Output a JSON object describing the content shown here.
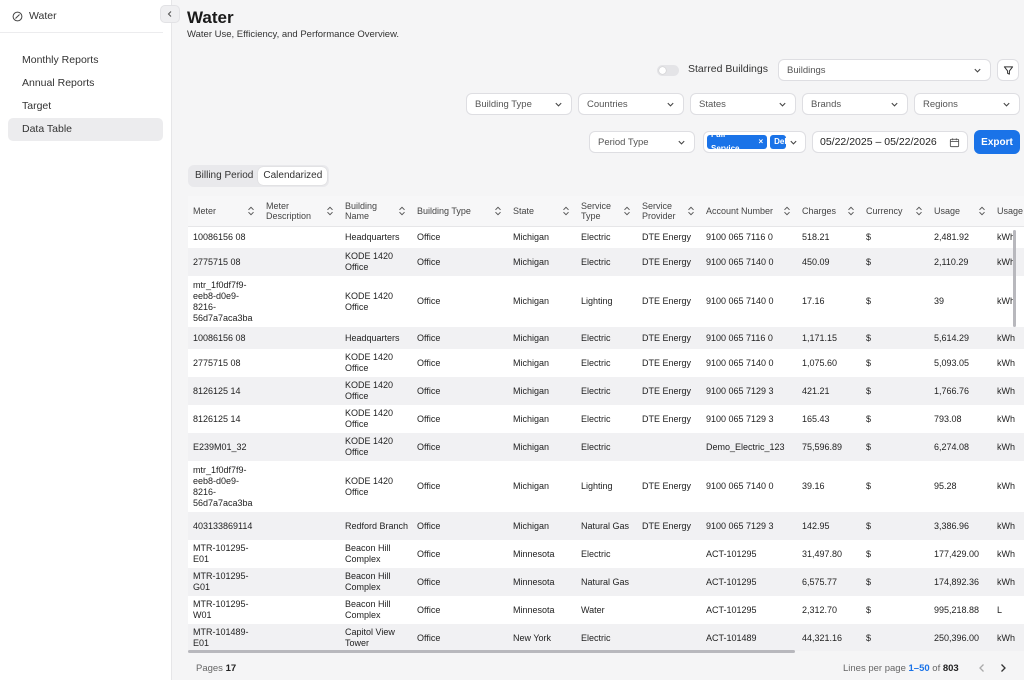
{
  "app": {
    "section_title": "Water",
    "section_icon": "leaf-icon"
  },
  "sidebar": {
    "items": [
      {
        "label": "Monthly Reports"
      },
      {
        "label": "Annual Reports"
      },
      {
        "label": "Target"
      },
      {
        "label": "Data Table",
        "active": true
      }
    ]
  },
  "header": {
    "title": "Water",
    "subtitle": "Water Use, Efficiency, and Performance Overview."
  },
  "filters": {
    "starred_label": "Starred Buildings",
    "buildings_placeholder": "Buildings",
    "building_type": "Building Type",
    "countries": "Countries",
    "states": "States",
    "brands": "Brands",
    "regions": "Regions",
    "period_type": "Period Type",
    "service_chips": [
      "Full Service",
      "Deli"
    ],
    "date_range": "05/22/2025 – 05/22/2026",
    "export_label": "Export"
  },
  "view_toggle": {
    "billing_period": "Billing Period",
    "calendarized": "Calendarized",
    "active": "Calendarized"
  },
  "table": {
    "columns": [
      "Meter",
      "Meter Description",
      "Building Name",
      "Building Type",
      "State",
      "Service Type",
      "Service Provider",
      "Account Number",
      "Charges",
      "Currency",
      "Usage",
      "Usage Unit"
    ],
    "rows": [
      [
        "10086156 08",
        "",
        "Headquarters",
        "Office",
        "Michigan",
        "Electric",
        "DTE Energy",
        "9100 065 7116 0",
        "518.21",
        "$",
        "2,481.92",
        "kWh"
      ],
      [
        "2775715 08",
        "",
        "KODE 1420 Office",
        "Office",
        "Michigan",
        "Electric",
        "DTE Energy",
        "9100 065 7140 0",
        "450.09",
        "$",
        "2,110.29",
        "kWh"
      ],
      [
        "mtr_1f0df7f9-eeb8-d0e9-8216-56d7a7aca3ba",
        "",
        "KODE 1420 Office",
        "Office",
        "Michigan",
        "Lighting",
        "DTE Energy",
        "9100 065 7140 0",
        "17.16",
        "$",
        "39",
        "kWh"
      ],
      [
        "10086156 08",
        "",
        "Headquarters",
        "Office",
        "Michigan",
        "Electric",
        "DTE Energy",
        "9100 065 7116 0",
        "1,171.15",
        "$",
        "5,614.29",
        "kWh"
      ],
      [
        "2775715 08",
        "",
        "KODE 1420 Office",
        "Office",
        "Michigan",
        "Electric",
        "DTE Energy",
        "9100 065 7140 0",
        "1,075.60",
        "$",
        "5,093.05",
        "kWh"
      ],
      [
        "8126125 14",
        "",
        "KODE 1420 Office",
        "Office",
        "Michigan",
        "Electric",
        "DTE Energy",
        "9100 065 7129 3",
        "421.21",
        "$",
        "1,766.76",
        "kWh"
      ],
      [
        "8126125 14",
        "",
        "KODE 1420 Office",
        "Office",
        "Michigan",
        "Electric",
        "DTE Energy",
        "9100 065 7129 3",
        "165.43",
        "$",
        "793.08",
        "kWh"
      ],
      [
        "E239M01_32",
        "",
        "KODE 1420 Office",
        "Office",
        "Michigan",
        "Electric",
        "",
        "Demo_Electric_123",
        "75,596.89",
        "$",
        "6,274.08",
        "kWh"
      ],
      [
        "mtr_1f0df7f9-eeb8-d0e9-8216-56d7a7aca3ba",
        "",
        "KODE 1420 Office",
        "Office",
        "Michigan",
        "Lighting",
        "DTE Energy",
        "9100 065 7140 0",
        "39.16",
        "$",
        "95.28",
        "kWh"
      ],
      [
        "403133869114",
        "",
        "Redford Branch",
        "Office",
        "Michigan",
        "Natural Gas",
        "DTE Energy",
        "9100 065 7129 3",
        "142.95",
        "$",
        "3,386.96",
        "kWh"
      ],
      [
        "MTR-101295-E01",
        "",
        "Beacon Hill Complex",
        "Office",
        "Minnesota",
        "Electric",
        "",
        "ACT-101295",
        "31,497.80",
        "$",
        "177,429.00",
        "kWh"
      ],
      [
        "MTR-101295-G01",
        "",
        "Beacon Hill Complex",
        "Office",
        "Minnesota",
        "Natural Gas",
        "",
        "ACT-101295",
        "6,575.77",
        "$",
        "174,892.36",
        "kWh"
      ],
      [
        "MTR-101295-W01",
        "",
        "Beacon Hill Complex",
        "Office",
        "Minnesota",
        "Water",
        "",
        "ACT-101295",
        "2,312.70",
        "$",
        "995,218.88",
        "L"
      ],
      [
        "MTR-101489-E01",
        "",
        "Capitol View Tower",
        "Office",
        "New York",
        "Electric",
        "",
        "ACT-101489",
        "44,321.16",
        "$",
        "250,396.00",
        "kWh"
      ]
    ]
  },
  "footer": {
    "pages_label": "Pages",
    "pages_value": "17",
    "lines_label": "Lines per page",
    "lines_range": "1–50",
    "of_label": "of",
    "total": "803"
  }
}
